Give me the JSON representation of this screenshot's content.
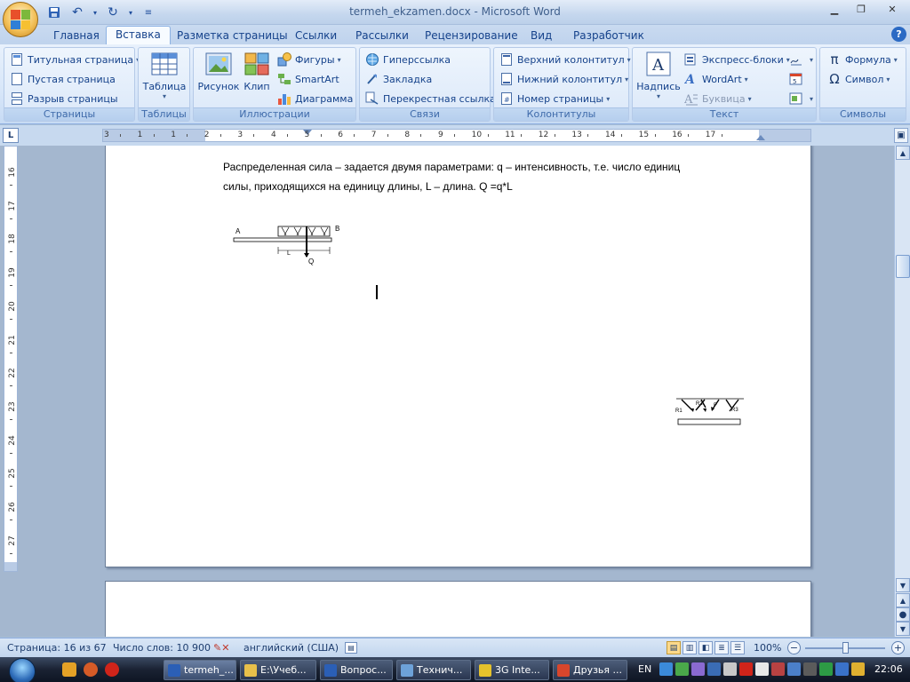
{
  "window": {
    "title": "termeh_ekzamen.docx - Microsoft Word"
  },
  "quick_access": [
    "save-icon",
    "undo-icon",
    "redo-icon",
    "customize-icon"
  ],
  "tabs": [
    {
      "label": "Главная",
      "active": false
    },
    {
      "label": "Вставка",
      "active": true
    },
    {
      "label": "Разметка страницы",
      "active": false
    },
    {
      "label": "Ссылки",
      "active": false
    },
    {
      "label": "Рассылки",
      "active": false
    },
    {
      "label": "Рецензирование",
      "active": false
    },
    {
      "label": "Вид",
      "active": false
    },
    {
      "label": "Разработчик",
      "active": false
    }
  ],
  "ribbon": {
    "pages": {
      "group_label": "Страницы",
      "cover_page": "Титульная страница",
      "blank_page": "Пустая страница",
      "page_break": "Разрыв страницы"
    },
    "tables": {
      "group_label": "Таблицы",
      "table": "Таблица"
    },
    "illustrations": {
      "group_label": "Иллюстрации",
      "picture": "Рисунок",
      "clip": "Клип",
      "shapes": "Фигуры",
      "smartart": "SmartArt",
      "chart": "Диаграмма"
    },
    "links": {
      "group_label": "Связи",
      "hyperlink": "Гиперссылка",
      "bookmark": "Закладка",
      "cross_reference": "Перекрестная ссылка"
    },
    "header_footer": {
      "group_label": "Колонтитулы",
      "header": "Верхний колонтитул",
      "footer": "Нижний колонтитул",
      "page_number": "Номер страницы"
    },
    "text": {
      "group_label": "Текст",
      "textbox": "Надпись",
      "quick_parts": "Экспресс-блоки",
      "wordart": "WordArt",
      "dropcap": "Буквица"
    },
    "symbols": {
      "group_label": "Символы",
      "equation": "Формула",
      "symbol": "Символ"
    }
  },
  "ruler": {
    "h_numbers": [
      "3",
      "1",
      "1",
      "2",
      "3",
      "4",
      "5",
      "6",
      "7",
      "8",
      "9",
      "10",
      "11",
      "12",
      "13",
      "14",
      "15",
      "16",
      "17"
    ],
    "v_numbers": [
      "16",
      "17",
      "18",
      "19",
      "20",
      "21",
      "22",
      "23",
      "24",
      "25",
      "26",
      "27"
    ]
  },
  "document": {
    "line1": "Распределенная сила – задается двумя параметрами: q – интенсивность, т.е. число единиц",
    "line2": "силы, приходящихся на единицу длины, L – длина. Q =q*L",
    "figure1": {
      "label_a": "A",
      "label_b": "B",
      "label_l": "L",
      "label_q": "Q"
    },
    "figure2": {
      "label_r1": "R1",
      "label_r2": "R2",
      "label_f": "F",
      "label_r3": "R3"
    }
  },
  "status": {
    "page": "Страница: 16 из 67",
    "words": "Число слов: 10 900",
    "language": "английский (США)",
    "zoom": "100%"
  },
  "taskbar": {
    "tasks": [
      {
        "label": "termeh_...",
        "color": "#2b5fb6",
        "active": true
      },
      {
        "label": "E:\\Учеб...",
        "color": "#e8c04a",
        "active": false
      },
      {
        "label": "Вопрос...",
        "color": "#2b5fb6",
        "active": false
      },
      {
        "label": "Технич...",
        "color": "#6da2d9",
        "active": false
      },
      {
        "label": "3G Inte...",
        "color": "#e5c22b",
        "active": false
      },
      {
        "label": "Друзья ...",
        "color": "#d8462c",
        "active": false
      }
    ],
    "language": "EN",
    "clock": "22:06"
  }
}
